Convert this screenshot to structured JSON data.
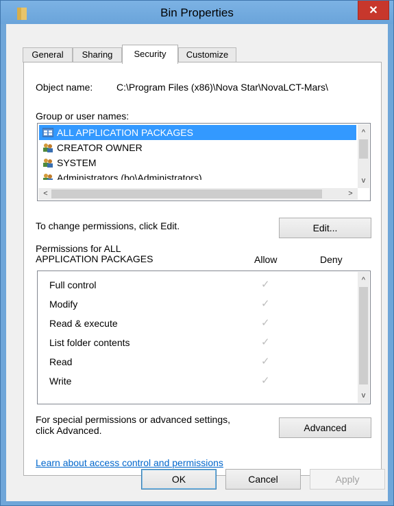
{
  "window": {
    "title": "Bin Properties",
    "close_glyph": "✕"
  },
  "tabs": [
    {
      "label": "General"
    },
    {
      "label": "Sharing"
    },
    {
      "label": "Security"
    },
    {
      "label": "Customize"
    }
  ],
  "object": {
    "label": "Object name:",
    "value": "C:\\Program Files (x86)\\Nova Star\\NovaLCT-Mars\\"
  },
  "groups": {
    "label": "Group or user names:",
    "items": [
      {
        "name": "ALL APPLICATION PACKAGES",
        "icon": "packages-icon"
      },
      {
        "name": "CREATOR OWNER",
        "icon": "users-icon"
      },
      {
        "name": "SYSTEM",
        "icon": "users-icon"
      },
      {
        "name": "Administrators (bo\\Administrators)",
        "icon": "users-icon"
      }
    ]
  },
  "change_permissions": {
    "text": "To change permissions, click Edit.",
    "edit_label": "Edit..."
  },
  "permissions": {
    "title_line1": "Permissions for ALL",
    "title_line2": "APPLICATION PACKAGES",
    "allow_header": "Allow",
    "deny_header": "Deny",
    "items": [
      {
        "name": "Full control",
        "allow": "✓"
      },
      {
        "name": "Modify",
        "allow": "✓"
      },
      {
        "name": "Read & execute",
        "allow": "✓"
      },
      {
        "name": "List folder contents",
        "allow": "✓"
      },
      {
        "name": "Read",
        "allow": "✓"
      },
      {
        "name": "Write",
        "allow": "✓"
      }
    ]
  },
  "advanced": {
    "text_line1": "For special permissions or advanced settings,",
    "text_line2": "click Advanced.",
    "button_label": "Advanced"
  },
  "link": {
    "text": "Learn about access control and permissions"
  },
  "footer": {
    "ok_label": "OK",
    "cancel_label": "Cancel",
    "apply_label": "Apply"
  },
  "colors": {
    "title_bar": "#6fa6d9",
    "close": "#c7372c",
    "selection": "#3399ff",
    "link": "#0066cc"
  }
}
